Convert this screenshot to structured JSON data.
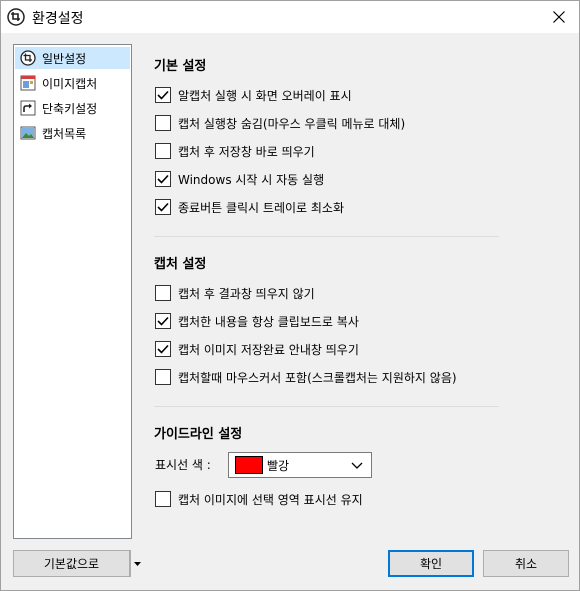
{
  "window": {
    "title": "환경설정"
  },
  "sidebar": {
    "items": [
      {
        "label": "일반설정",
        "icon": "general-settings-icon",
        "selected": true
      },
      {
        "label": "이미지캡처",
        "icon": "image-capture-icon",
        "selected": false
      },
      {
        "label": "단축키설정",
        "icon": "shortcut-icon",
        "selected": false
      },
      {
        "label": "캡처목록",
        "icon": "capture-list-icon",
        "selected": false
      }
    ]
  },
  "basic": {
    "title": "기본 설정",
    "options": [
      {
        "label": "알캡처 실행 시 화면 오버레이 표시",
        "checked": true
      },
      {
        "label": "캡처 실행창 숨김(마우스 우클릭 메뉴로 대체)",
        "checked": false
      },
      {
        "label": "캡처 후 저장창 바로 띄우기",
        "checked": false
      },
      {
        "label": "Windows 시작 시 자동 실행",
        "checked": true
      },
      {
        "label": "종료버튼 클릭시 트레이로 최소화",
        "checked": true
      }
    ]
  },
  "capture": {
    "title": "캡처 설정",
    "options": [
      {
        "label": "캡처 후 결과창 띄우지 않기",
        "checked": false
      },
      {
        "label": "캡처한 내용을 항상 클립보드로 복사",
        "checked": true
      },
      {
        "label": "캡처 이미지 저장완료 안내창 띄우기",
        "checked": true
      },
      {
        "label": "캡처할때 마우스커서 포함(스크롤캡처는 지원하지 않음)",
        "checked": false
      }
    ]
  },
  "guide": {
    "title": "가이드라인 설정",
    "color_label": "표시선 색 :",
    "color_value": "빨강",
    "color_hex": "#ff0000",
    "options": [
      {
        "label": "캡처 이미지에 선택 영역 표시선 유지",
        "checked": false
      }
    ]
  },
  "buttons": {
    "defaults_label": "기본값으로",
    "ok_label": "확인",
    "cancel_label": "취소"
  }
}
